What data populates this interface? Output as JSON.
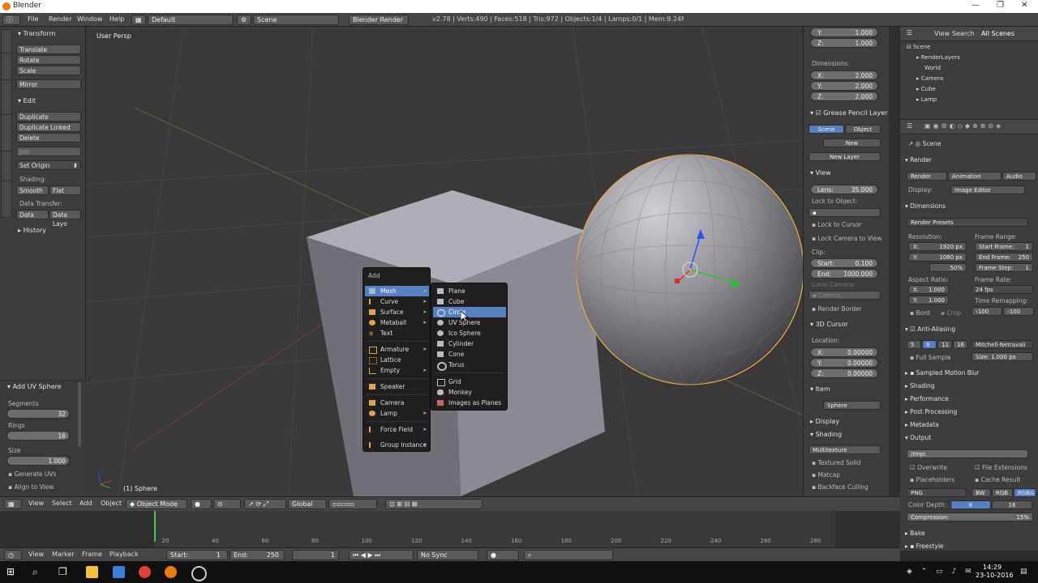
{
  "window": {
    "title": "Blender"
  },
  "info_header": {
    "menus": [
      "File",
      "Render",
      "Window",
      "Help"
    ],
    "layout": "Default",
    "scene": "Scene",
    "engine": "Blender Render",
    "stats": "v2.78 | Verts:490 | Faces:518 | Tris:972 | Objects:1/4 | Lamps:0/1 | Mem:9.24M | Sphere"
  },
  "toolshelf": {
    "transform_header": "Transform",
    "transform_buttons": [
      "Translate",
      "Rotate",
      "Scale",
      "Mirror"
    ],
    "edit_header": "Edit",
    "edit_buttons": [
      "Duplicate",
      "Duplicate Linked",
      "Delete",
      "Join"
    ],
    "set_origin": "Set Origin",
    "shading_label": "Shading:",
    "smooth": "Smooth",
    "flat": "Flat",
    "data_transfer_label": "Data Transfer:",
    "data": "Data",
    "data_layout": "Data Layo",
    "history_header": "History",
    "tabs": [
      "Tools",
      "Create",
      "Relations",
      "Animation",
      "Physics",
      "Grease Pencil"
    ]
  },
  "operator_panel": {
    "title": "Add UV Sphere",
    "segments_label": "Segments",
    "segments": "32",
    "rings_label": "Rings",
    "rings": "16",
    "size_label": "Size",
    "size": "1.000",
    "generate_uvs": "Generate UVs",
    "align_to_view": "Align to View"
  },
  "viewport": {
    "view_label": "User Persp",
    "object_label": "(1) Sphere"
  },
  "add_menu": {
    "title": "Add",
    "items": [
      {
        "label": "Mesh",
        "arrow": "▸",
        "selected": true
      },
      {
        "label": "Curve",
        "arrow": "▸"
      },
      {
        "label": "Surface",
        "arrow": "▸"
      },
      {
        "label": "Metaball",
        "arrow": "▸"
      },
      {
        "label": "Text",
        "arrow": ""
      },
      {
        "label": "Armature",
        "arrow": "▸"
      },
      {
        "label": "Lattice",
        "arrow": ""
      },
      {
        "label": "Empty",
        "arrow": "▸"
      },
      {
        "label": "Speaker",
        "arrow": ""
      },
      {
        "label": "Camera",
        "arrow": ""
      },
      {
        "label": "Lamp",
        "arrow": "▸"
      },
      {
        "label": "Force Field",
        "arrow": "▸"
      },
      {
        "label": "Group Instance",
        "arrow": "▸"
      }
    ],
    "mesh_items": [
      {
        "label": "Plane"
      },
      {
        "label": "Cube"
      },
      {
        "label": "Circle",
        "selected": true
      },
      {
        "label": "UV Sphere"
      },
      {
        "label": "Ico Sphere"
      },
      {
        "label": "Cylinder"
      },
      {
        "label": "Cone"
      },
      {
        "label": "Torus"
      },
      {
        "label": "Grid"
      },
      {
        "label": "Monkey"
      },
      {
        "label": "Images as Planes"
      }
    ]
  },
  "npanel": {
    "scale_y": "1.000",
    "scale_z": "1.000",
    "dimensions_label": "Dimensions:",
    "dim_x": "2.000",
    "dim_y": "2.000",
    "dim_z": "2.000",
    "grease_pencil": "Grease Pencil Layers",
    "scene_btn": "Scene",
    "object_btn": "Object",
    "new_btn": "New",
    "new_layer_btn": "New Layer",
    "view_header": "View",
    "lens_label": "Lens:",
    "lens": "35.000",
    "lock_to_object": "Lock to Object:",
    "lock_to_cursor": "Lock to Cursor",
    "lock_camera_to_view": "Lock Camera to View",
    "clip_label": "Clip:",
    "clip_start_label": "Start:",
    "clip_start": "0.100",
    "clip_end_label": "End:",
    "clip_end": "1000.000",
    "local_camera": "Local Camera:",
    "camera": "Camera",
    "render_border": "Render Border",
    "cursor_header": "3D Cursor",
    "location_label": "Location:",
    "cur_x": "0.00000",
    "cur_y": "0.00000",
    "cur_z": "0.00000",
    "item_header": "Item",
    "item_name": "Sphere",
    "display_header": "Display",
    "shading_header": "Shading",
    "multitexture": "Multitexture",
    "textured_solid": "Textured Solid",
    "matcap": "Matcap",
    "backface_culling": "Backface Culling"
  },
  "outliner": {
    "view": "View",
    "search": "Search",
    "all_scenes": "All Scenes",
    "rows": [
      "Scene",
      "RenderLayers",
      "World",
      "Camera",
      "Cube",
      "Lamp"
    ]
  },
  "properties": {
    "scene": "Scene",
    "render_header": "Render",
    "render_btn": "Render",
    "animation_btn": "Animation",
    "audio_btn": "Audio",
    "display_label": "Display:",
    "display_value": "Image Editor",
    "dimensions_header": "Dimensions",
    "render_presets": "Render Presets",
    "resolution_label": "Resolution:",
    "res_x": "1920 px",
    "res_y": "1080 px",
    "res_pct": "50%",
    "frame_range_label": "Frame Range:",
    "start_frame": "Start Frame:",
    "start_frame_val": "1",
    "end_frame": "End Frame:",
    "end_frame_val": "250",
    "frame_step": "Frame Step:",
    "frame_step_val": "1",
    "aspect_label": "Aspect Ratio:",
    "asp_x": "1.000",
    "asp_y": "1.000",
    "frame_rate_label": "Frame Rate:",
    "fps": "24 fps",
    "time_remap": "Time Remapping:",
    "remap_old": "100",
    "remap_new": "100",
    "bord": "Bord",
    "crop": "Crop",
    "aa_header": "Anti-Aliasing",
    "aa_vals": [
      "5",
      "8",
      "11",
      "16"
    ],
    "aa_filter": "Mitchell-Netravali",
    "full_sample": "Full Sample",
    "aa_size": "Size: 1.000 px",
    "sampled_motion_blur": "Sampled Motion Blur",
    "shading": "Shading",
    "performance": "Performance",
    "post_processing": "Post Processing",
    "metadata": "Metadata",
    "output": "Output",
    "output_path": "/tmp\\",
    "overwrite": "Overwrite",
    "file_extensions": "File Extensions",
    "placeholders": "Placeholders",
    "cache_result": "Cache Result",
    "format": "PNG",
    "bw": "BW",
    "rgb": "RGB",
    "rgba": "RGBA",
    "color_depth_label": "Color Depth:",
    "depth_8": "8",
    "depth_16": "16",
    "compression_label": "Compression:",
    "compression": "15%",
    "bake": "Bake",
    "freestyle": "Freestyle"
  },
  "view3d_header": {
    "view": "View",
    "select": "Select",
    "add": "Add",
    "object": "Object",
    "mode": "Object Mode",
    "orientation": "Global"
  },
  "timeline": {
    "ticks": [
      "-40",
      "-20",
      "0",
      "20",
      "40",
      "60",
      "80",
      "100",
      "120",
      "140",
      "160",
      "180",
      "200",
      "220",
      "240",
      "260",
      "280"
    ],
    "current_frame_fraction": 0.5,
    "view": "View",
    "marker": "Marker",
    "frame": "Frame",
    "playback": "Playback",
    "start_label": "Start:",
    "start": "1",
    "end_label": "End:",
    "end": "250",
    "current": "1",
    "sync": "No Sync"
  },
  "taskbar": {
    "time": "14:29",
    "date": "23-10-2016"
  },
  "colors": {
    "selection": "#5680c2",
    "object_outline": "#f2a83b",
    "accent": "#e87d0d"
  }
}
